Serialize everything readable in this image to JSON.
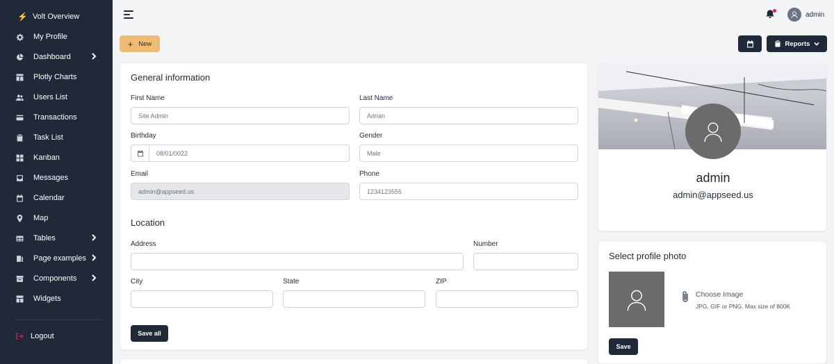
{
  "sidebar": {
    "brand": "Volt Overview",
    "items": [
      {
        "label": "My Profile",
        "icon": "gear-icon",
        "has_children": false
      },
      {
        "label": "Dashboard",
        "icon": "pie-chart-icon",
        "has_children": true
      },
      {
        "label": "Plotly Charts",
        "icon": "layout-icon",
        "has_children": false
      },
      {
        "label": "Users List",
        "icon": "users-icon",
        "has_children": false
      },
      {
        "label": "Transactions",
        "icon": "credit-card-icon",
        "has_children": false
      },
      {
        "label": "Task List",
        "icon": "clipboard-icon",
        "has_children": false
      },
      {
        "label": "Kanban",
        "icon": "grid-icon",
        "has_children": false
      },
      {
        "label": "Messages",
        "icon": "inbox-icon",
        "has_children": false
      },
      {
        "label": "Calendar",
        "icon": "calendar-icon",
        "has_children": false
      },
      {
        "label": "Map",
        "icon": "map-pin-icon",
        "has_children": false
      },
      {
        "label": "Tables",
        "icon": "table-icon",
        "has_children": true
      },
      {
        "label": "Page examples",
        "icon": "pages-icon",
        "has_children": true
      },
      {
        "label": "Components",
        "icon": "archive-icon",
        "has_children": true
      },
      {
        "label": "Widgets",
        "icon": "widgets-icon",
        "has_children": false
      }
    ],
    "logout_label": "Logout"
  },
  "topbar": {
    "user_name": "admin",
    "has_notification": true
  },
  "actions": {
    "new_label": "New",
    "reports_label": "Reports"
  },
  "general": {
    "title": "General information",
    "first_name_label": "First Name",
    "first_name_placeholder": "Site Admin",
    "last_name_label": "Last Name",
    "last_name_placeholder": "Adrian",
    "birthday_label": "Birthday",
    "birthday_value": "08/01/0022",
    "gender_label": "Gender",
    "gender_placeholder": "Male",
    "email_label": "Email",
    "email_value": "admin@appseed.us",
    "phone_label": "Phone",
    "phone_placeholder": "1234123555"
  },
  "location": {
    "title": "Location",
    "address_label": "Address",
    "number_label": "Number",
    "city_label": "City",
    "state_label": "State",
    "zip_label": "ZIP",
    "save_label": "Save all"
  },
  "profile": {
    "name": "admin",
    "email": "admin@appseed.us"
  },
  "photo": {
    "title": "Select profile photo",
    "choose_label": "Choose Image",
    "hint": "JPG, GIF or PNG. Max size of 800K",
    "save_label": "Save"
  },
  "colors": {
    "sidebar_bg": "#1f2937",
    "accent": "#f0bc74",
    "notification": "#e11d48"
  }
}
